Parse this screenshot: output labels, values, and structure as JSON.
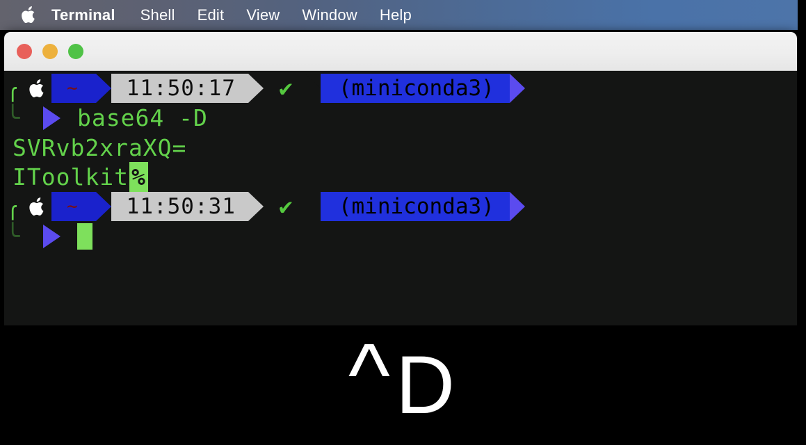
{
  "menubar": {
    "apple_icon": "apple-logo-icon",
    "items": [
      {
        "label": "Terminal",
        "bold": true
      },
      {
        "label": "Shell",
        "bold": false
      },
      {
        "label": "Edit",
        "bold": false
      },
      {
        "label": "View",
        "bold": false
      },
      {
        "label": "Window",
        "bold": false
      },
      {
        "label": "Help",
        "bold": false
      }
    ]
  },
  "window": {
    "title": "",
    "traffic_lights": {
      "close": "close-button",
      "minimize": "minimize-button",
      "maximize": "maximize-button"
    },
    "colors": {
      "close": "#e8605a",
      "minimize": "#edb13d",
      "maximize": "#4fc246",
      "titlebar": "#efefef",
      "terminal_bg": "#141514",
      "green_text": "#63d24b",
      "powerline_blue": "#1a22cc",
      "powerline_gray": "#c9c9c9",
      "powerline_purple": "#5b4bef",
      "conda_blue": "#2030dd"
    }
  },
  "terminal": {
    "prompt1": {
      "bracket": "╭",
      "apple_icon": "apple-logo-icon",
      "tilde": "~",
      "time": "11:50:17",
      "status_icon": "✔",
      "env": "(miniconda3)"
    },
    "command_line": {
      "bracket": "╰",
      "caret_icon": "prompt-caret-icon",
      "command": "base64 -D"
    },
    "output": [
      {
        "text": "SVRvb2xraXQ=",
        "marker": ""
      },
      {
        "text": "IToolkit",
        "marker": "%"
      }
    ],
    "prompt2": {
      "bracket": "╭",
      "apple_icon": "apple-logo-icon",
      "tilde": "~",
      "time": "11:50:31",
      "status_icon": "✔",
      "env": "(miniconda3)"
    },
    "input_line": {
      "bracket": "╰",
      "caret_icon": "prompt-caret-icon",
      "cursor": "block-cursor"
    }
  },
  "overlay": {
    "caret": "^",
    "key": "D",
    "background": "#000000",
    "foreground": "#ffffff"
  }
}
